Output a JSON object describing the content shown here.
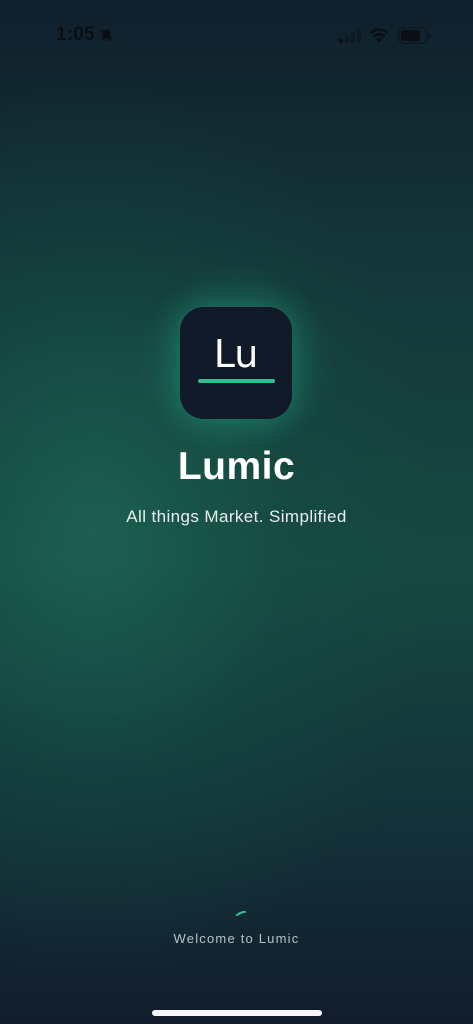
{
  "status_bar": {
    "time": "1:05",
    "icons": [
      "bell-silent-icon",
      "cellular-signal-icon",
      "wifi-icon",
      "battery-icon"
    ]
  },
  "splash": {
    "icon_text": "Lu",
    "app_name": "Lumic",
    "tagline": "All things Market. Simplified",
    "loading_text": "Welcome to Lumic"
  },
  "colors": {
    "accent": "#2fbf8f",
    "icon_background": "#111a29",
    "background_top": "#101f2c",
    "background_mid": "#17493f",
    "background_bottom": "#121c2d"
  }
}
